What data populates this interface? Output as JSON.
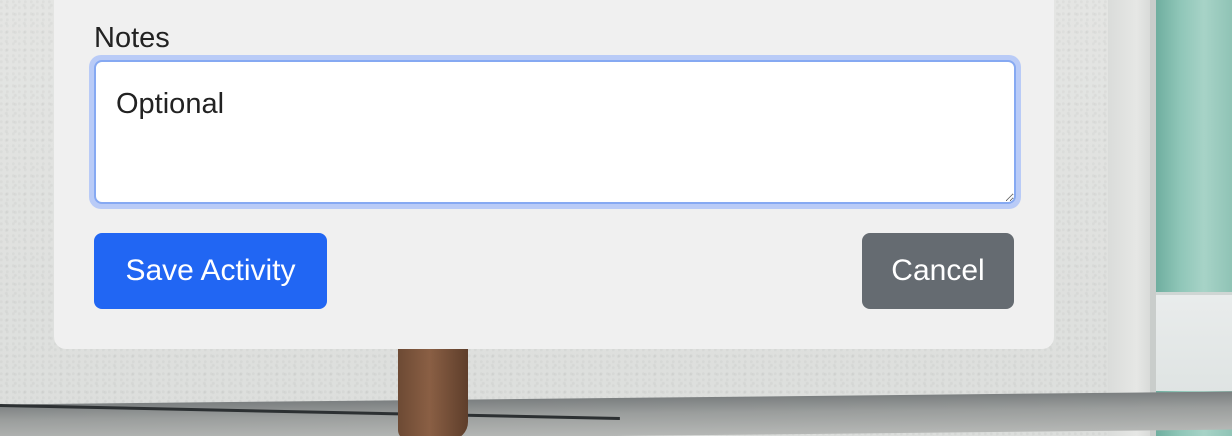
{
  "form": {
    "notes_label": "Notes",
    "notes_value": "Optional",
    "save_button_label": "Save Activity",
    "cancel_button_label": "Cancel"
  },
  "colors": {
    "primary_button": "#2166f3",
    "secondary_button": "#656b71",
    "focus_ring": "#b9cbf7",
    "card_background": "#f0f0f0"
  }
}
